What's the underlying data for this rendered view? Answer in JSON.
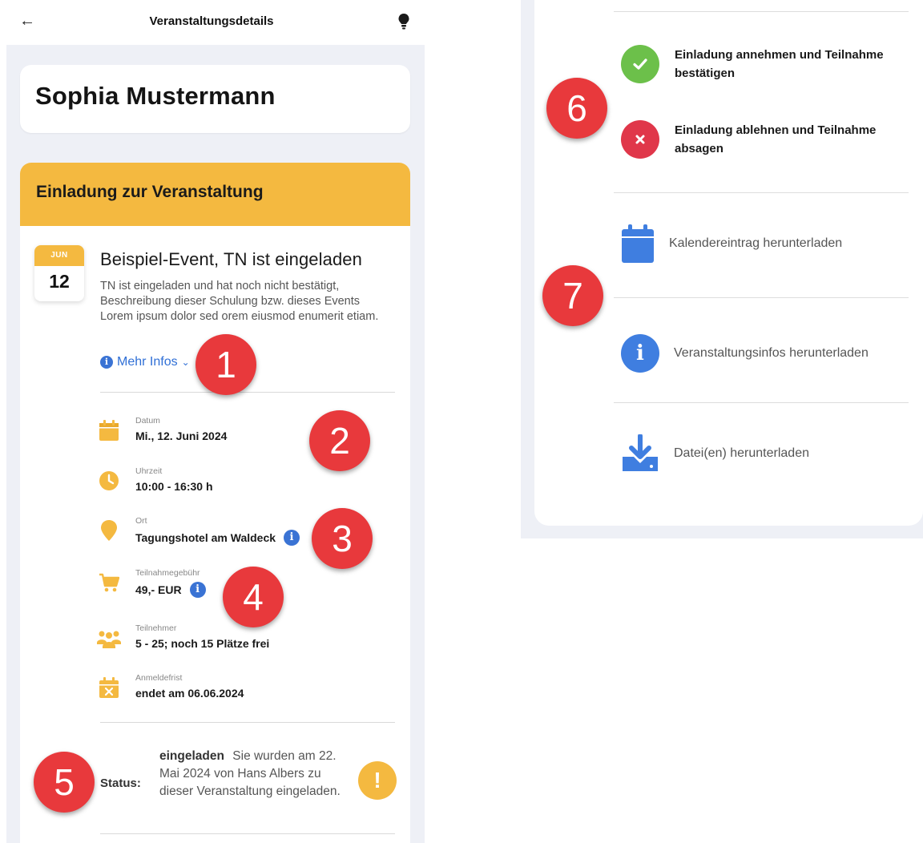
{
  "header": {
    "title": "Veranstaltungsdetails",
    "back_icon": "arrow-left-icon",
    "bulb_icon": "lightbulb-icon"
  },
  "person": {
    "name": "Sophia Mustermann"
  },
  "invitation": {
    "heading": "Einladung zur Veranstaltung",
    "date_badge": {
      "month": "JUN",
      "day": "12"
    },
    "title": "Beispiel-Event, TN ist eingeladen",
    "description": "TN ist eingeladen und hat noch nicht bestätigt, Beschreibung dieser Schulung bzw. dieses Events Lorem ipsum dolor sed orem eiusmod enumerit etiam.",
    "more_info": "Mehr Infos",
    "details": [
      {
        "label": "Datum",
        "value": "Mi., 12. Juni 2024",
        "icon": "calendar-icon"
      },
      {
        "label": "Uhrzeit",
        "value": "10:00 - 16:30 h",
        "icon": "clock-icon"
      },
      {
        "label": "Ort",
        "value": "Tagungshotel am Waldeck",
        "icon": "location-pin-icon"
      },
      {
        "label": "Teilnahmegebühr",
        "value": "49,- EUR",
        "icon": "cart-icon"
      },
      {
        "label": "Teilnehmer",
        "value": "5 - 25; noch 15 Plätze frei",
        "icon": "people-icon"
      },
      {
        "label": "Anmeldefrist",
        "value": "endet am 06.06.2024",
        "icon": "calendar-x-icon"
      }
    ],
    "status": {
      "label": "Status:",
      "state": "eingeladen",
      "text": "Sie wurden am 22. Mai 2024 von Hans Albers zu dieser Veranstaltung eingeladen.",
      "icon": "exclamation-icon"
    }
  },
  "actions": {
    "accept": {
      "label": "Einladung annehmen und Teilnahme bestätigen",
      "icon": "check-icon",
      "color": "#6cc04a"
    },
    "decline": {
      "label": "Einladung ablehnen und Teilnahme absagen",
      "icon": "close-icon",
      "color": "#e0374a"
    },
    "downloads": [
      {
        "label": "Kalendereintrag herunterladen",
        "icon": "calendar-icon"
      },
      {
        "label": "Veranstaltungsinfos herunterladen",
        "icon": "info-icon"
      },
      {
        "label": "Datei(en) herunterladen",
        "icon": "download-icon"
      }
    ]
  },
  "markers": [
    "1",
    "2",
    "3",
    "4",
    "5",
    "6",
    "7"
  ],
  "colors": {
    "accent": "#f4b940",
    "link": "#2f6fd6",
    "marker": "#e8393c",
    "background": "#eef0f6"
  }
}
